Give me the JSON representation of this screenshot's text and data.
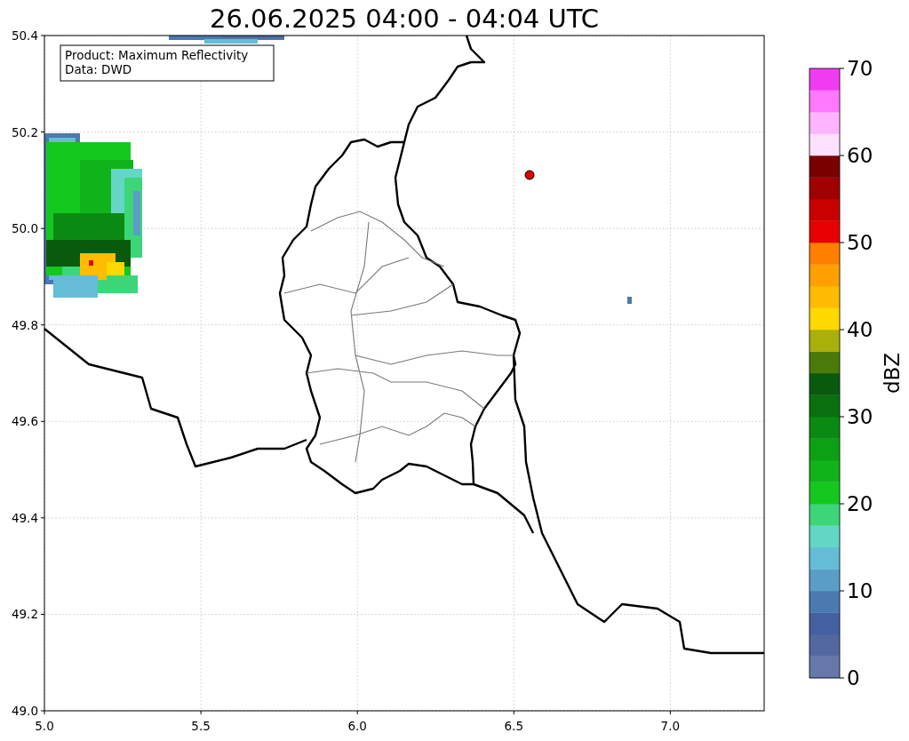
{
  "title": "26.06.2025 04:00 - 04:04 UTC",
  "info_box": {
    "lines": [
      "Product: Maximum Reflectivity",
      "Data: DWD"
    ]
  },
  "map": {
    "x_ticks": [
      "5.0",
      "5.5",
      "6.0",
      "6.5",
      "7.0"
    ],
    "y_ticks": [
      "50.4",
      "50.2",
      "50.0",
      "49.8",
      "49.6",
      "49.4",
      "49.2",
      "49.0"
    ]
  },
  "colorbar": {
    "label": "dBZ",
    "ticks": [
      "70",
      "60",
      "50",
      "40",
      "30",
      "20",
      "10",
      "0"
    ],
    "bins": [
      {
        "color": "#6677a9"
      },
      {
        "color": "#5468a0"
      },
      {
        "color": "#4460a0"
      },
      {
        "color": "#4a7ab0"
      },
      {
        "color": "#5a9ec6"
      },
      {
        "color": "#64bcd6"
      },
      {
        "color": "#64d6c6"
      },
      {
        "color": "#3cd678"
      },
      {
        "color": "#14c81e"
      },
      {
        "color": "#10b41a"
      },
      {
        "color": "#0ca014"
      },
      {
        "color": "#0a8a12"
      },
      {
        "color": "#0a7010"
      },
      {
        "color": "#0a5a0e"
      },
      {
        "color": "#4a7a0a"
      },
      {
        "color": "#aab00a"
      },
      {
        "color": "#ffd800"
      },
      {
        "color": "#ffbc00"
      },
      {
        "color": "#ffa000"
      },
      {
        "color": "#ff8000"
      },
      {
        "color": "#e60000"
      },
      {
        "color": "#c80000"
      },
      {
        "color": "#a00000"
      },
      {
        "color": "#780000"
      },
      {
        "color": "#ffe0ff"
      },
      {
        "color": "#ffb4ff"
      },
      {
        "color": "#ff78ff"
      },
      {
        "color": "#f03cf0"
      }
    ]
  }
}
